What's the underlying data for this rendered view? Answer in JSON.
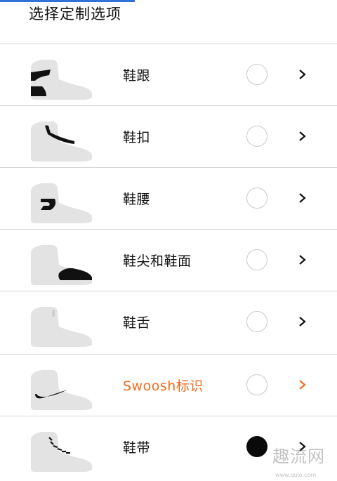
{
  "progress": {
    "fraction": 0.4
  },
  "header": {
    "title": "选择定制选项"
  },
  "accent_color": "#f36a1d",
  "items": [
    {
      "label": "鞋跟",
      "selected": false,
      "active": false,
      "highlight": "heel",
      "icon": "shoe-heel-thumbnail"
    },
    {
      "label": "鞋扣",
      "selected": false,
      "active": false,
      "highlight": "strap",
      "icon": "shoe-strap-thumbnail"
    },
    {
      "label": "鞋腰",
      "selected": false,
      "active": false,
      "highlight": "waist",
      "icon": "shoe-waist-thumbnail"
    },
    {
      "label": "鞋尖和鞋面",
      "selected": false,
      "active": false,
      "highlight": "toe",
      "icon": "shoe-toe-thumbnail"
    },
    {
      "label": "鞋舌",
      "selected": false,
      "active": false,
      "highlight": "tongue",
      "icon": "shoe-tongue-thumbnail"
    },
    {
      "label": "Swoosh标识",
      "selected": false,
      "active": true,
      "highlight": "swoosh",
      "icon": "shoe-swoosh-thumbnail"
    },
    {
      "label": "鞋带",
      "selected": true,
      "active": false,
      "highlight": "laces",
      "icon": "shoe-laces-thumbnail"
    }
  ],
  "watermark": {
    "text": "趣流网",
    "url": "www.qulo.com"
  }
}
